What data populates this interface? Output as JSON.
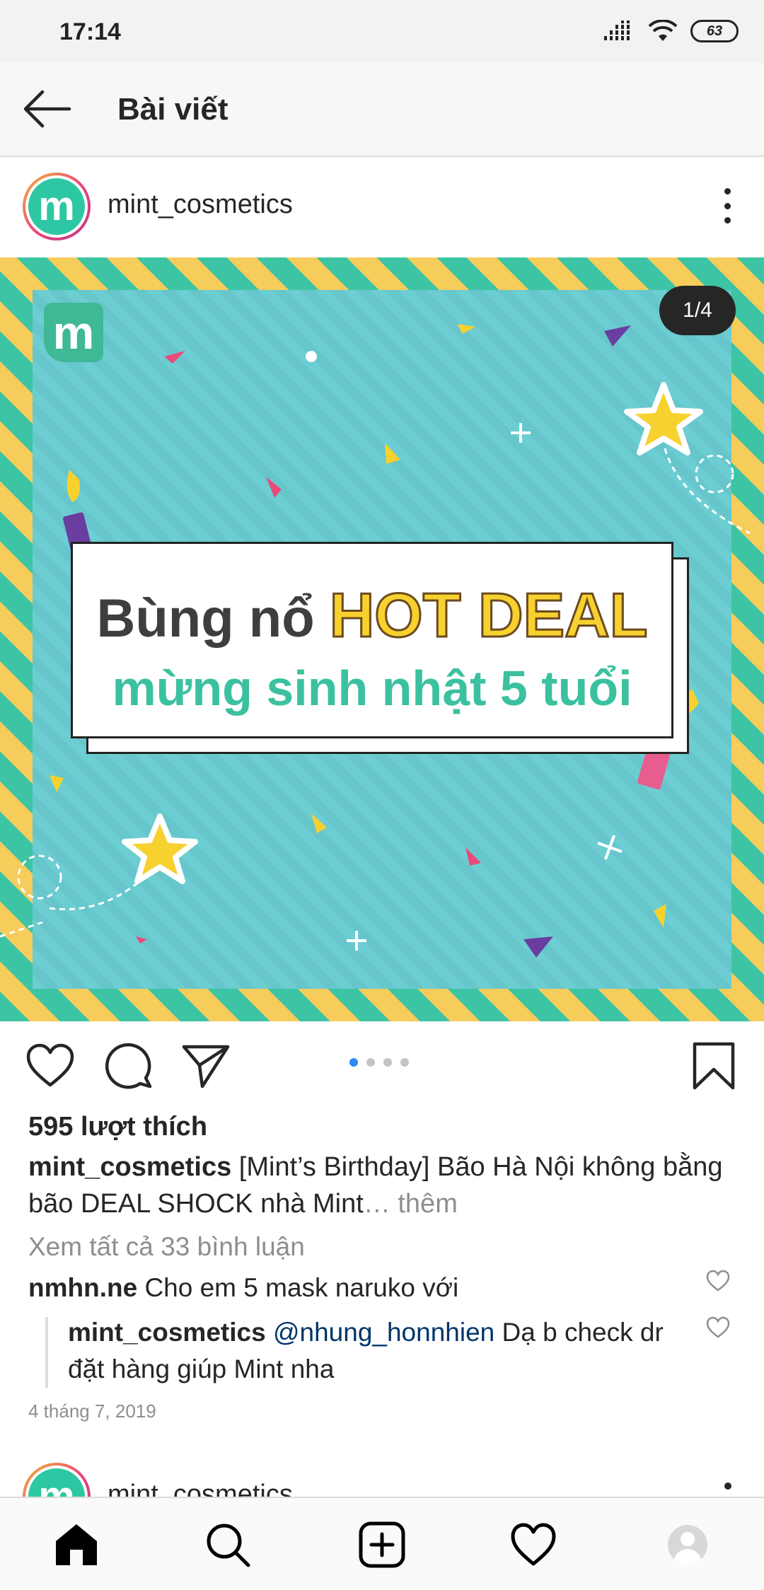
{
  "status_bar": {
    "time": "17:14",
    "battery": "63"
  },
  "header": {
    "title": "Bài viết"
  },
  "post": {
    "username": "mint_cosmetics",
    "avatar_letter": "m",
    "image": {
      "counter": "1/4",
      "logo_letter": "m",
      "line1_dark": "Bùng nổ ",
      "line1_highlight": "HOT DEAL",
      "line2": "mừng sinh nhật 5 tuổi"
    },
    "carousel": {
      "total": 4,
      "active_index": 0
    },
    "likes": "595 lượt thích",
    "caption": {
      "username": "mint_cosmetics",
      "text": " [Mint’s Birthday] Bão Hà Nội không bằng bão DEAL SHOCK nhà Mint",
      "more": "… thêm"
    },
    "view_comments": "Xem tất cả 33 bình luận",
    "comments": [
      {
        "username": "nmhn.ne",
        "text": " Cho em 5 mask naruko với"
      },
      {
        "username": "mint_cosmetics",
        "mention": " @nhung_honnhien",
        "text": " Dạ b check dr đặt hàng giúp Mint nha"
      }
    ],
    "date": "4 tháng 7, 2019"
  },
  "next_post": {
    "username": "mint_cosmetics",
    "avatar_letter": "m"
  },
  "colors": {
    "brand_teal": "#3cc4a4",
    "stripe_yellow": "#f6cc5a",
    "accent_blue": "#2a8bf2",
    "muted": "#8e8e8e"
  },
  "icons": [
    "back-arrow-icon",
    "more-vertical-icon",
    "heart-icon",
    "comment-icon",
    "share-icon",
    "bookmark-icon",
    "home-icon",
    "search-icon",
    "add-icon",
    "activity-heart-icon",
    "profile-icon",
    "signal-icon",
    "wifi-icon",
    "battery-icon"
  ]
}
